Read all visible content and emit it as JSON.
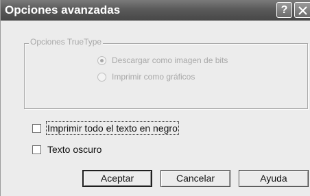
{
  "window": {
    "title": "Opciones avanzadas",
    "help_glyph": "?"
  },
  "truetype_group": {
    "label": "Opciones TrueType",
    "options": [
      {
        "label": "Descargar como imagen de bits",
        "selected": true,
        "enabled": false
      },
      {
        "label": "Imprimir como gráficos",
        "selected": false,
        "enabled": false
      }
    ]
  },
  "checkboxes": [
    {
      "label": "Imprimir todo el texto en negro",
      "checked": false,
      "focused": true
    },
    {
      "label": "Texto oscuro",
      "checked": false,
      "focused": false
    }
  ],
  "buttons": {
    "accept": "Aceptar",
    "cancel": "Cancelar",
    "help": "Ayuda"
  },
  "colors": {
    "titlebar": "#5a5a5a",
    "dialog_bg": "#ececec",
    "disabled_text": "#a8a8a8"
  }
}
